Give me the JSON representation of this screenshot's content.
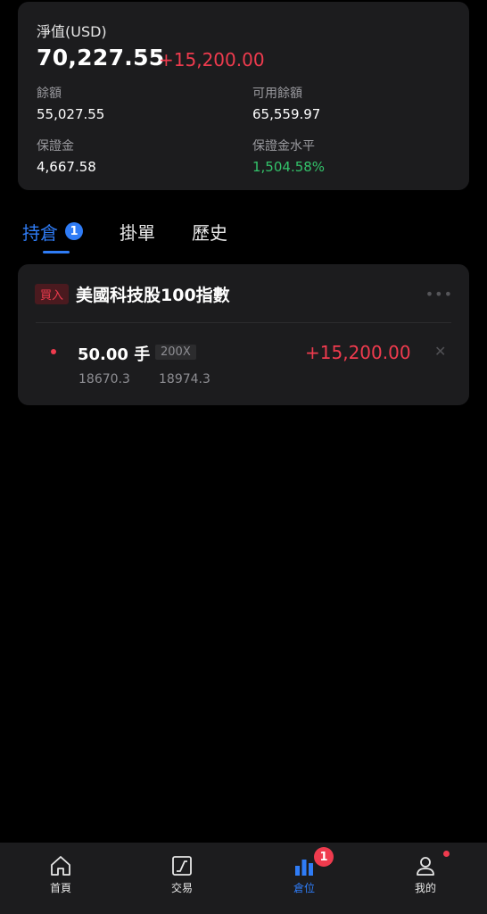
{
  "account": {
    "net_value_label": "淨值(USD)",
    "net_value": "70,227.55",
    "net_pnl": "+15,200.00",
    "balance_label": "餘額",
    "balance": "55,027.55",
    "available_label": "可用餘額",
    "available": "65,559.97",
    "margin_label": "保證金",
    "margin": "4,667.58",
    "margin_level_label": "保證金水平",
    "margin_level": "1,504.58%"
  },
  "tabs": [
    {
      "label": "持倉",
      "badge": "1",
      "active": true
    },
    {
      "label": "掛單"
    },
    {
      "label": "歷史"
    }
  ],
  "position": {
    "side": "買入",
    "instrument": "美國科技股100指數",
    "lots": "50.00 手",
    "leverage": "200X",
    "pnl": "+15,200.00",
    "open_price": "18670.3",
    "current_price": "18974.3",
    "more_icon": "more-icon",
    "close_icon": "close-icon"
  },
  "nav": [
    {
      "label": "首頁",
      "icon": "home-icon"
    },
    {
      "label": "交易",
      "icon": "chart-icon"
    },
    {
      "label": "倉位",
      "icon": "positions-icon",
      "badge": "1",
      "active": true
    },
    {
      "label": "我的",
      "icon": "user-icon"
    }
  ],
  "colors": {
    "accent": "#2f7cf6",
    "loss_red": "#ef3b4e",
    "gain_green": "#33c26a",
    "card_bg": "#1c1c1e"
  }
}
